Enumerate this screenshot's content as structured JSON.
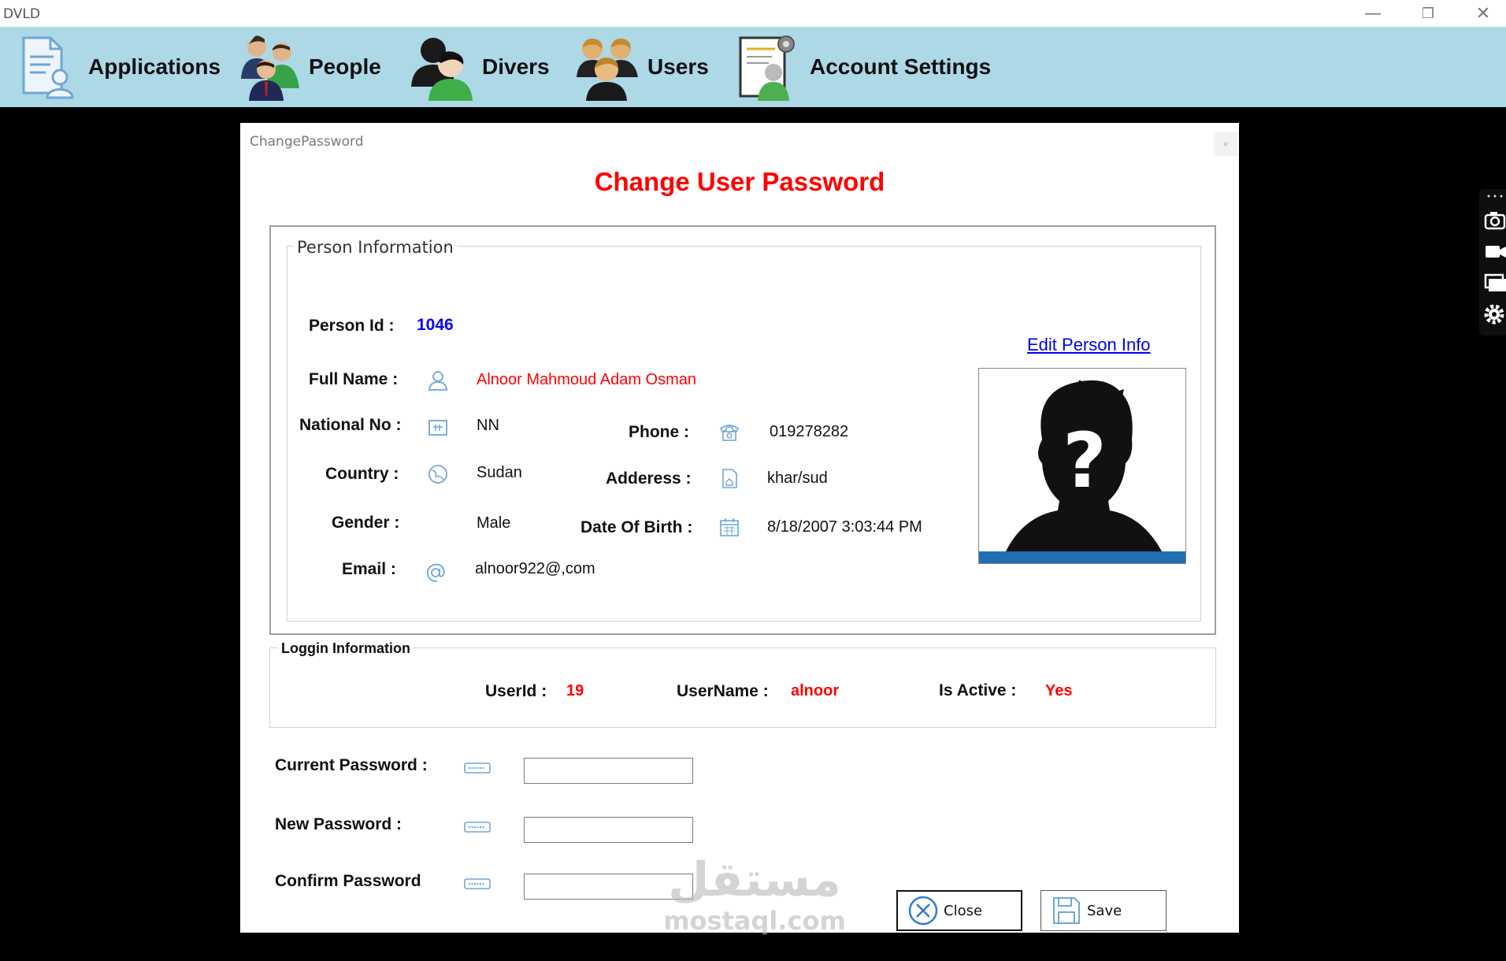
{
  "window": {
    "title": "DVLD",
    "minimize_glyph": "—",
    "restore_glyph": "❐",
    "close_glyph": "✕"
  },
  "menu": {
    "items": [
      {
        "label": "Applications",
        "icon": "applications-icon"
      },
      {
        "label": "People",
        "icon": "people-icon"
      },
      {
        "label": "Divers",
        "icon": "drivers-icon"
      },
      {
        "label": "Users",
        "icon": "users-icon"
      },
      {
        "label": "Account Settings",
        "icon": "account-settings-icon"
      }
    ]
  },
  "dialog": {
    "title": "ChangePassword",
    "close_glyph": "×",
    "heading": "Change User Password"
  },
  "person": {
    "group_title": "Person Information",
    "edit_link": "Edit Person Info",
    "person_id_label": "Person Id :",
    "person_id": "1046",
    "full_name_label": "Full Name :",
    "full_name": "Alnoor Mahmoud Adam Osman",
    "national_no_label": "National No :",
    "national_no": "NN",
    "phone_label": "Phone :",
    "phone": "019278282",
    "country_label": "Country :",
    "country": "Sudan",
    "address_label": "Adderess :",
    "address": "khar/sud",
    "gender_label": "Gender :",
    "gender": "Male",
    "dob_label": "Date Of Birth :",
    "dob": "8/18/2007 3:03:44 PM",
    "email_label": "Email :",
    "email": "alnoor922@,com"
  },
  "login": {
    "group_title": "Loggin Information",
    "user_id_label": "UserId :",
    "user_id": "19",
    "username_label": "UserName :",
    "username": "alnoor",
    "is_active_label": "Is Active :",
    "is_active": "Yes"
  },
  "passwords": {
    "current_label": "Current Password :",
    "current_value": "",
    "new_label": "New Password :",
    "new_value": "",
    "confirm_label": "Confirm Password",
    "confirm_value": ""
  },
  "buttons": {
    "close_label": "Close",
    "save_label": "Save"
  },
  "watermark": {
    "arabic": "مستقل",
    "latin": "mostaql.com"
  },
  "colors": {
    "menu_bg": "#add8e6",
    "heading": "#ff0000",
    "link": "#0000ee",
    "person_id": "#0000ff",
    "icon_blue": "#6fa7d6"
  }
}
